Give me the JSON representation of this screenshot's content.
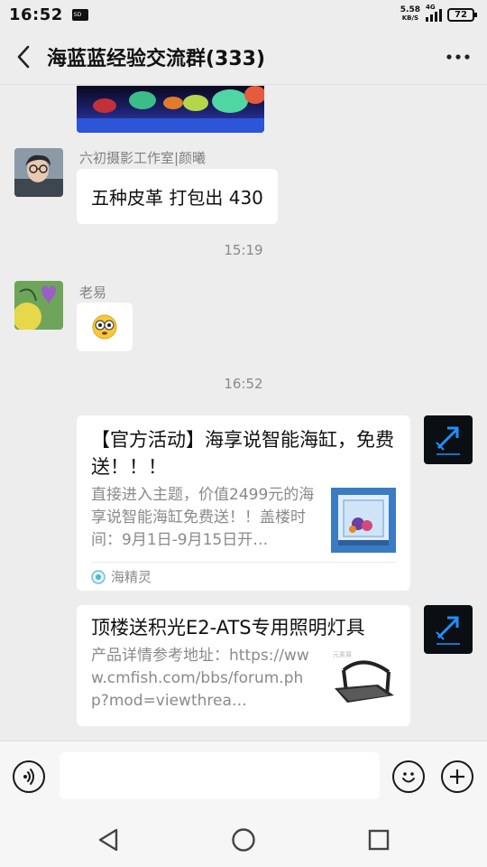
{
  "status_bar": {
    "time": "16:52",
    "sd_label": "SD",
    "net_speed_value": "5.58",
    "net_speed_unit": "KB/S",
    "network_type": "4G",
    "battery": "72"
  },
  "header": {
    "title": "海蓝蓝经验交流群(333)",
    "back_icon": "chevron-left-icon",
    "more_icon": "more-dots-icon"
  },
  "messages": [
    {
      "type": "image",
      "description_icon": "aquarium-image"
    },
    {
      "type": "text",
      "sender": "六初摄影工作室|颜曦",
      "text": "五种皮革 打包出 430"
    },
    {
      "type": "time",
      "text": "15:19"
    },
    {
      "type": "text",
      "sender": "老易",
      "text": "emoji-flushed"
    },
    {
      "type": "time",
      "text": "16:52"
    },
    {
      "type": "card",
      "title": "【官方活动】海享说智能海缸，免费送！！！",
      "description": "直接进入主题，价值2499元的海享说智能海缸免费送！！盖楼时间：9月1日-9月15日开…",
      "source": "海精灵"
    },
    {
      "type": "card",
      "title": "顶楼送积光E2-ATS专用照明灯具",
      "description": "产品详情参考地址：https://www.cmfish.com/bbs/forum.php?mod=viewthrea…",
      "thumb_text": "元素展"
    }
  ],
  "input_bar": {
    "placeholder": "",
    "voice_icon": "voice-icon",
    "emoji_icon": "emoji-icon",
    "plus_icon": "plus-icon"
  },
  "colors": {
    "background": "#ededed",
    "bubble": "#ffffff",
    "secondary_text": "#8a8a8a"
  }
}
